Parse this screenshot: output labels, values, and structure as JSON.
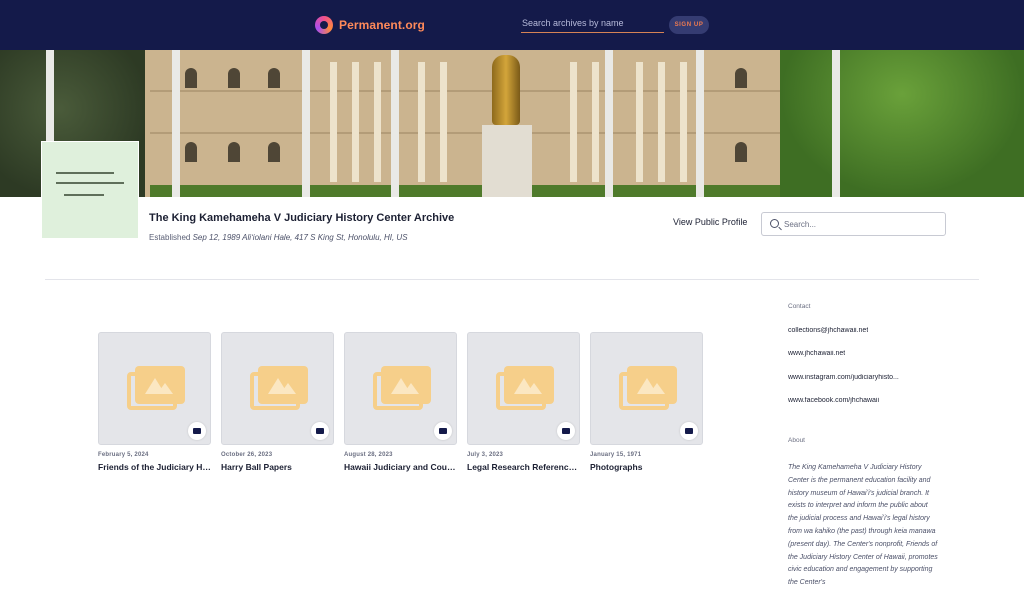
{
  "header": {
    "brand_name": "Permanent.org",
    "search_placeholder": "Search archives by name",
    "signup_label": "SIGN UP"
  },
  "archive": {
    "title": "The King Kamehameha V Judiciary History Center Archive",
    "established_label": "Established",
    "established_detail": "Sep 12, 1989 Aliʻiolani Hale, 417 S King St, Honolulu, HI, US",
    "view_profile_label": "View Public Profile",
    "search_placeholder": "Search..."
  },
  "folders": [
    {
      "date": "February 5, 2024",
      "name": "Friends of the Judiciary His..."
    },
    {
      "date": "October 26, 2023",
      "name": "Harry Ball Papers"
    },
    {
      "date": "August 28, 2023",
      "name": "Hawaii Judiciary and Court ..."
    },
    {
      "date": "July 3, 2023",
      "name": "Legal Research Reference (..."
    },
    {
      "date": "January 15, 1971",
      "name": "Photographs"
    }
  ],
  "sidebar": {
    "contact_label": "Contact",
    "contacts": [
      "collections@jhchawaii.net",
      "www.jhchawaii.net",
      "www.instagram.com/judiciaryhisto...",
      "www.facebook.com/jhchawaii"
    ],
    "about_label": "About",
    "about_text": "The King Kamehameha V Judiciary History Center is the permanent education facility and history museum of Hawaiʻi's judicial branch. It exists to interpret and inform the public about the judicial process and Hawaiʻi's legal history from wa kahiko (the past) through keia manawa (present day). The Center's nonprofit, Friends of the Judiciary History Center of Hawaii, promotes civic education and engagement by supporting the Center's"
  },
  "colors": {
    "topbar": "#141a4a",
    "brand_accent": "#ff8a5a",
    "folder_icon": "#f6cf8a"
  }
}
